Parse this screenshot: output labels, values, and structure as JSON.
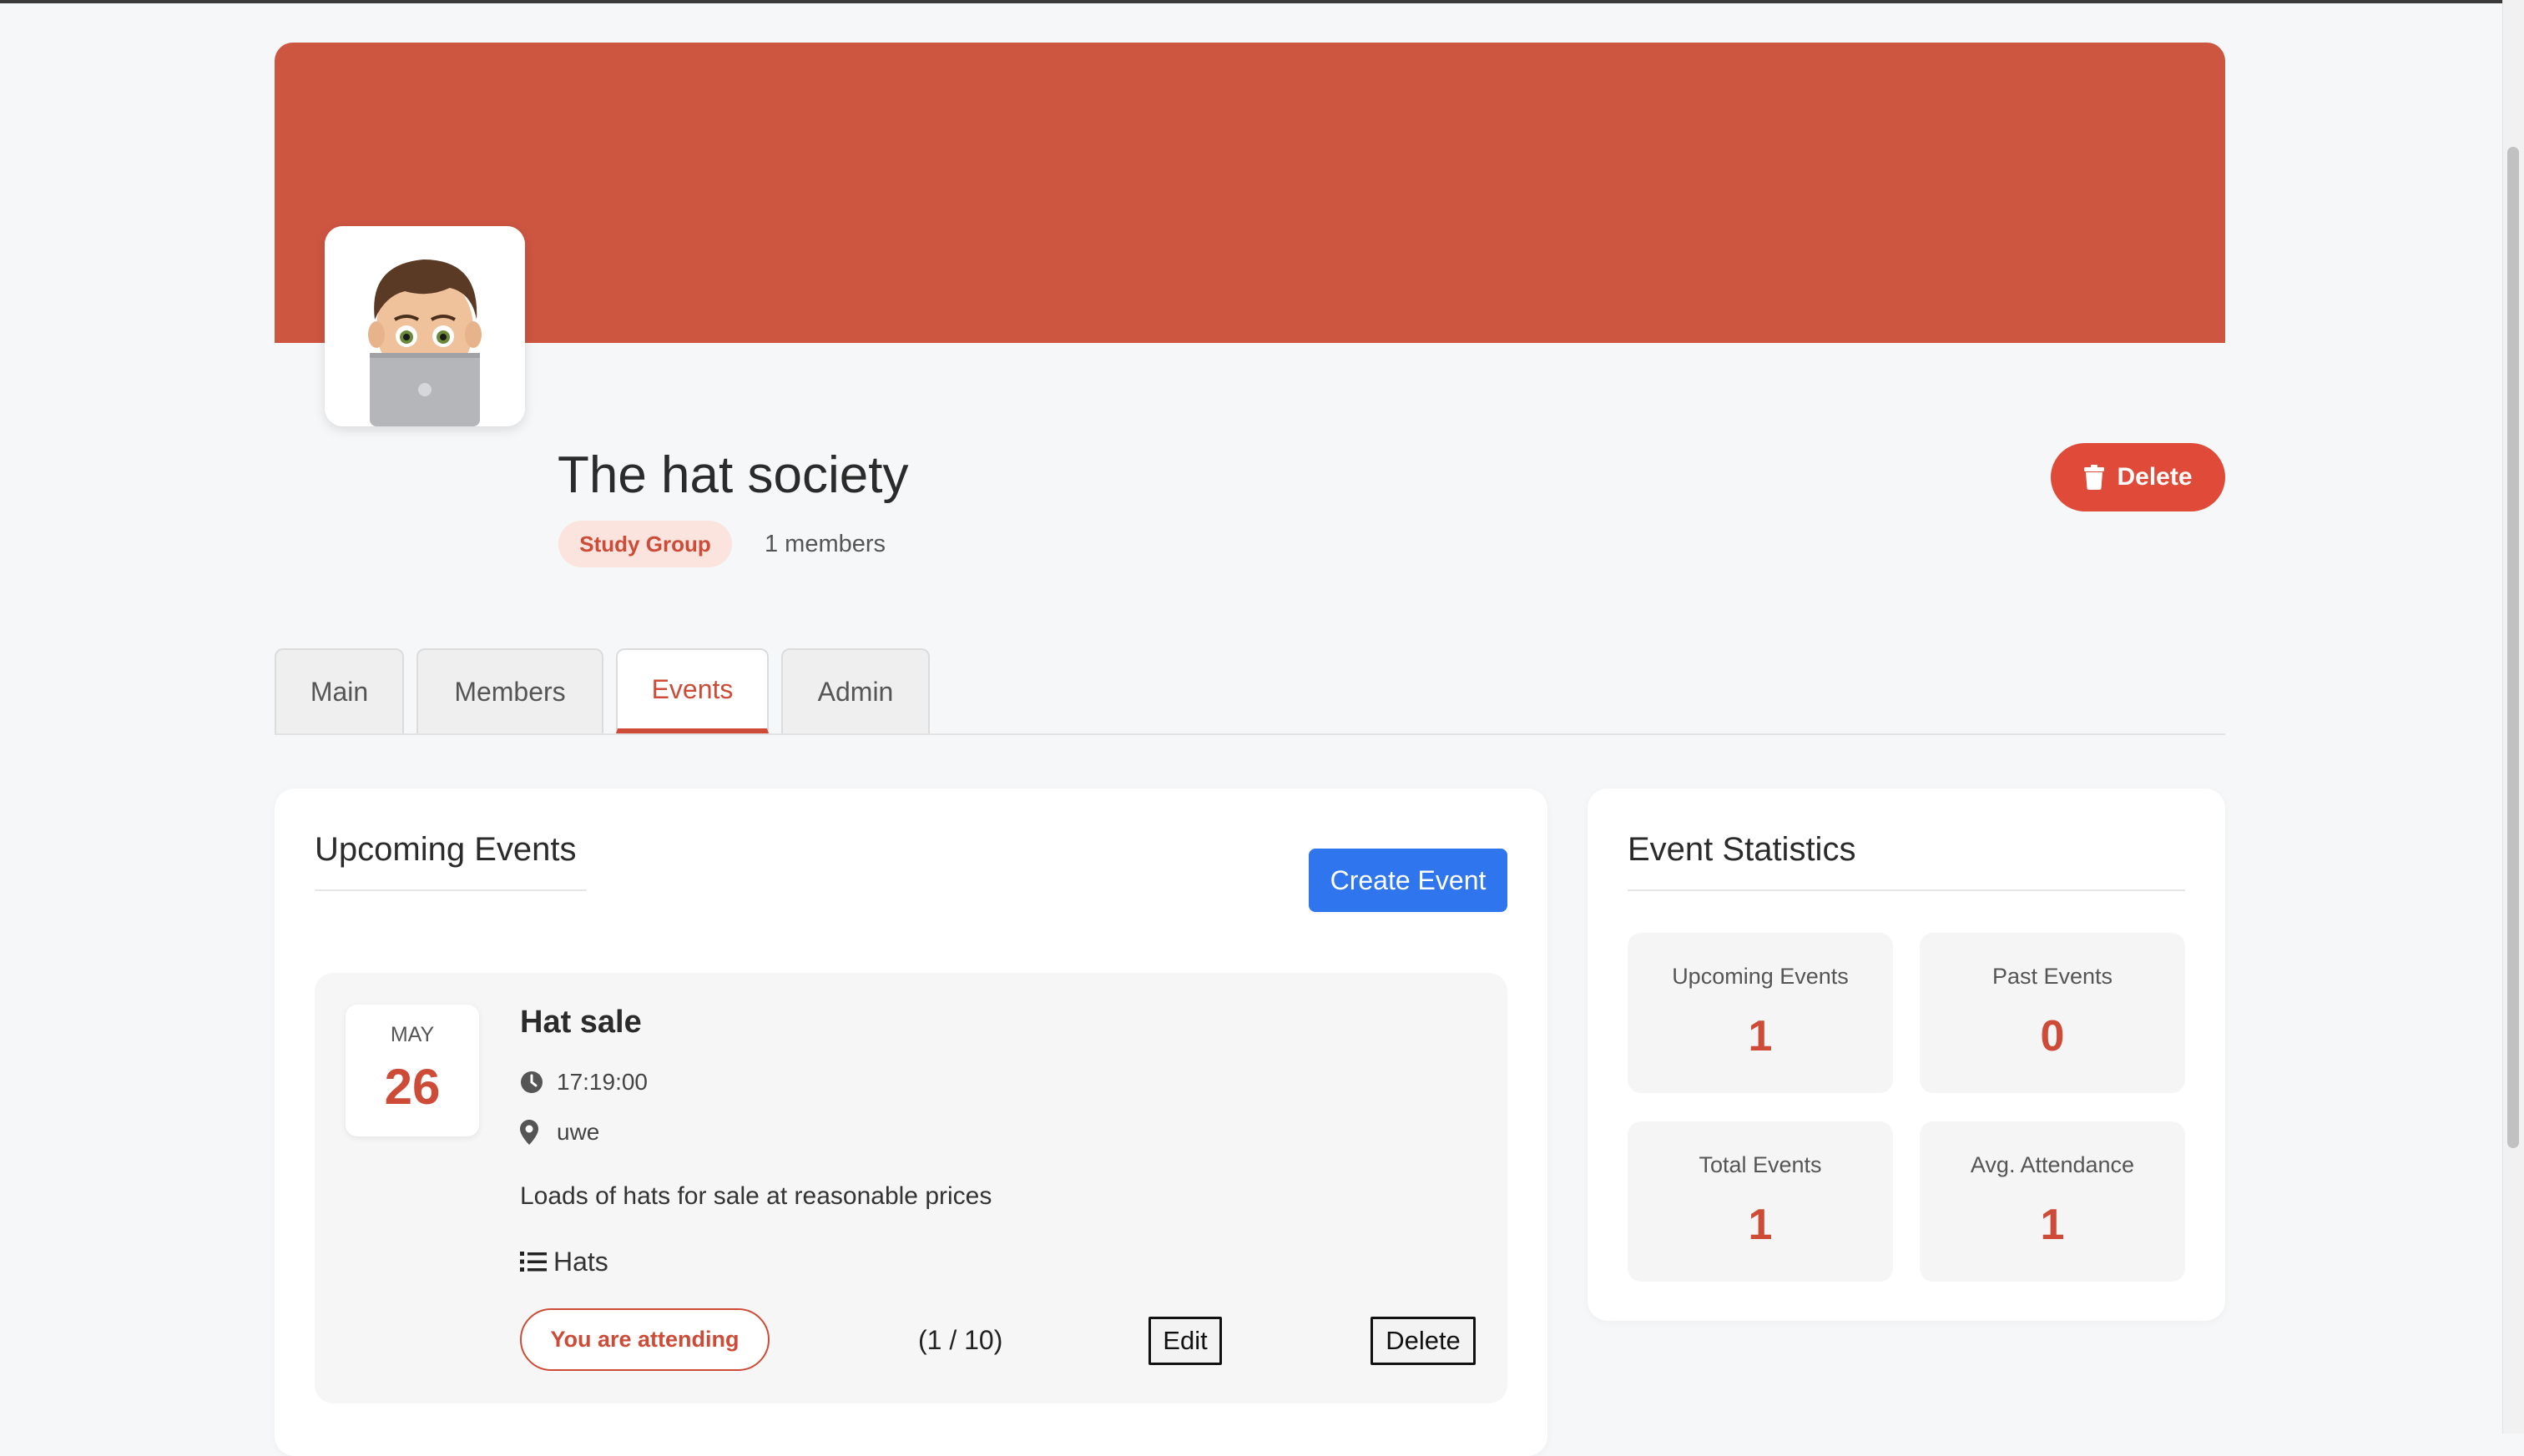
{
  "colors": {
    "brand": "#cd5641",
    "accent_red": "#cd4b37",
    "primary_blue": "#2f76ee",
    "page_bg": "#f6f7f9"
  },
  "group": {
    "name": "The hat society",
    "type_badge": "Study Group",
    "members_text": "1 members",
    "delete_label": "Delete",
    "avatar_icon": "memoji-laptop-avatar"
  },
  "tabs": [
    {
      "label": "Main",
      "active": false
    },
    {
      "label": "Members",
      "active": false
    },
    {
      "label": "Events",
      "active": true
    },
    {
      "label": "Admin",
      "active": false
    }
  ],
  "events_panel": {
    "heading": "Upcoming Events",
    "create_label": "Create Event",
    "events": [
      {
        "month": "MAY",
        "day": "26",
        "title": "Hat sale",
        "time": "17:19:00",
        "location": "uwe",
        "description": "Loads of hats for sale at reasonable prices",
        "category": "Hats",
        "attending_label": "You are attending",
        "attendance": "(1 / 10)",
        "edit_label": "Edit",
        "delete_label": "Delete"
      }
    ]
  },
  "stats_panel": {
    "heading": "Event Statistics",
    "items": [
      {
        "label": "Upcoming Events",
        "value": "1"
      },
      {
        "label": "Past Events",
        "value": "0"
      },
      {
        "label": "Total Events",
        "value": "1"
      },
      {
        "label": "Avg. Attendance",
        "value": "1"
      }
    ]
  }
}
